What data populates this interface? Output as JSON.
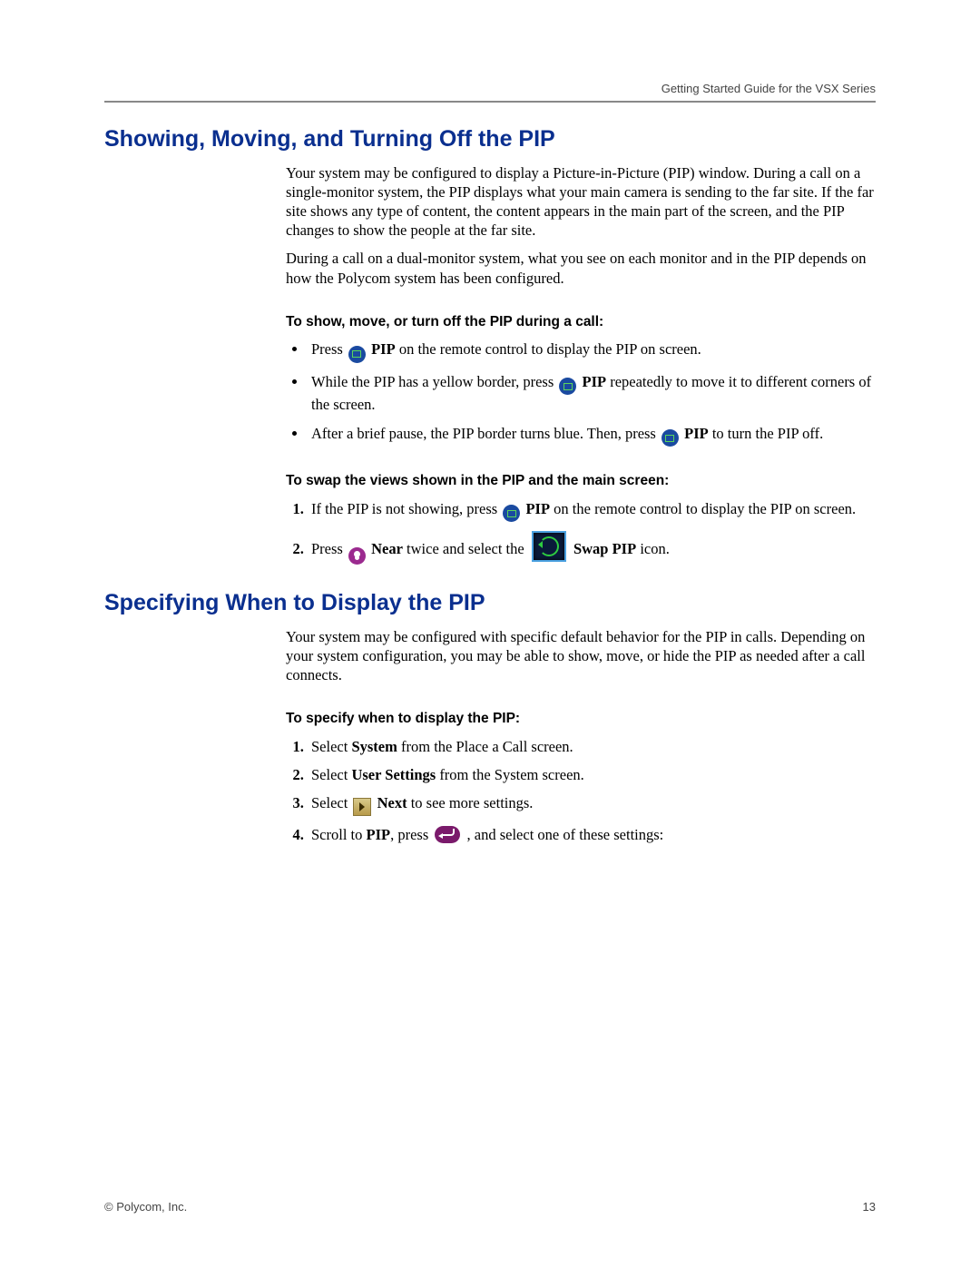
{
  "header": {
    "running": "Getting Started Guide for the VSX Series"
  },
  "section1": {
    "title": "Showing, Moving, and Turning Off the PIP",
    "para1": "Your system may be configured to display a Picture-in-Picture (PIP) window. During a call on a single-monitor system, the PIP displays what your main camera is sending to the far site. If the far site shows any type of content, the content appears in the main part of the screen, and the PIP changes to show the people at the far site.",
    "para2": "During a call on a dual-monitor system, what you see on each monitor and in the PIP depends on how the Polycom system has been configured.",
    "sub1": "To show, move, or turn off the PIP during a call:",
    "b1_a": "Press ",
    "b1_b": " PIP",
    "b1_c": " on the remote control to display the PIP on screen.",
    "b2_a": "While the PIP has a yellow border, press ",
    "b2_b": " PIP",
    "b2_c": " repeatedly to move it to different corners of the screen.",
    "b3_a": "After a brief pause, the PIP border turns blue. Then, press ",
    "b3_b": " PIP",
    "b3_c": " to turn the PIP off.",
    "sub2": "To swap the views shown in the PIP and the main screen:",
    "s1_a": "If the PIP is not showing, press ",
    "s1_b": " PIP",
    "s1_c": " on the remote control to display the PIP on screen.",
    "s2_a": "Press ",
    "s2_b": " Near",
    "s2_c": " twice and select the ",
    "s2_d": " Swap PIP",
    "s2_e": " icon."
  },
  "section2": {
    "title": "Specifying When to Display the PIP",
    "para1": "Your system may be configured with specific default behavior for the PIP in calls. Depending on your system configuration, you may be able to show, move, or hide the PIP as needed after a call connects.",
    "sub1": "To specify when to display the PIP:",
    "s1_a": "Select ",
    "s1_b": "System",
    "s1_c": " from the Place a Call screen.",
    "s2_a": "Select ",
    "s2_b": "User Settings",
    "s2_c": " from the System screen.",
    "s3_a": "Select ",
    "s3_b": " Next",
    "s3_c": " to see more settings.",
    "s4_a": "Scroll to ",
    "s4_b": "PIP",
    "s4_c": ", press ",
    "s4_d": " , and select one of these settings:"
  },
  "footer": {
    "left": "© Polycom, Inc.",
    "right": "13"
  }
}
